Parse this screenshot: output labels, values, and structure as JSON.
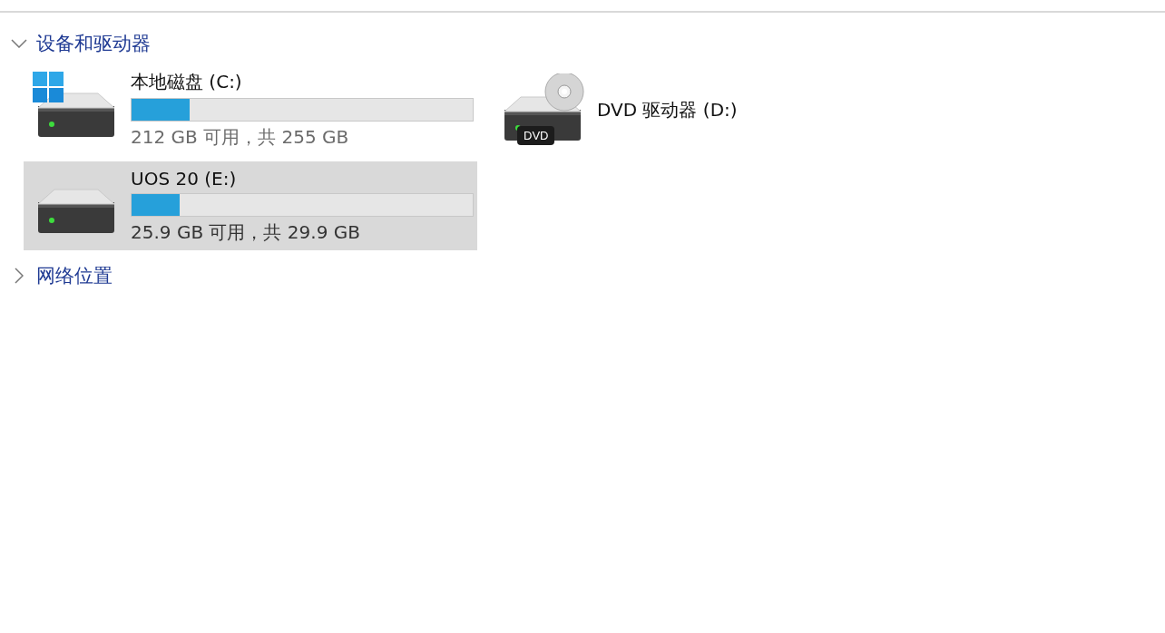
{
  "groups": [
    {
      "title": "设备和驱动器",
      "expanded": true,
      "items": [
        {
          "kind": "system",
          "name": "本地磁盘 (C:)",
          "level": 0.17,
          "detail": "212 GB 可用，共 255 GB",
          "selected": false
        },
        {
          "kind": "dvd",
          "name": "DVD 驱动器 (D:)",
          "badge": "DVD",
          "selected": false
        },
        {
          "kind": "disk",
          "name": "UOS 20 (E:)",
          "level": 0.14,
          "detail": "25.9 GB 可用，共 29.9 GB",
          "selected": true
        }
      ]
    },
    {
      "title": "网络位置",
      "expanded": false
    }
  ]
}
